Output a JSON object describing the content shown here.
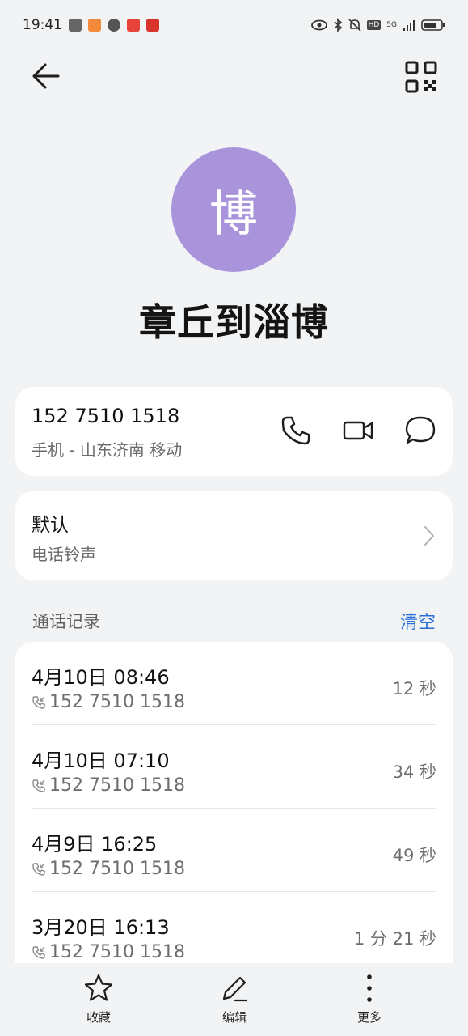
{
  "status_bar": {
    "time": "19:41",
    "signal_label": "5G",
    "hd_label": "HD"
  },
  "contact": {
    "avatar_char": "博",
    "name": "章丘到淄博",
    "avatar_color": "#a994dc"
  },
  "phone_card": {
    "number": "152 7510 1518",
    "description": "手机 - 山东济南 移动"
  },
  "ringtone_card": {
    "title": "默认",
    "subtitle": "电话铃声"
  },
  "call_log": {
    "title": "通话记录",
    "clear_label": "清空",
    "entries": [
      {
        "time": "4月10日 08:46",
        "number": "152 7510 1518",
        "duration": "12 秒"
      },
      {
        "time": "4月10日 07:10",
        "number": "152 7510 1518",
        "duration": "34 秒"
      },
      {
        "time": "4月9日 16:25",
        "number": "152 7510 1518",
        "duration": "49 秒"
      },
      {
        "time": "3月20日 16:13",
        "number": "152 7510 1518",
        "duration": "1 分 21 秒"
      }
    ]
  },
  "bottom_bar": {
    "favorite_label": "收藏",
    "edit_label": "编辑",
    "more_label": "更多"
  },
  "colors": {
    "accent": "#2a6fd8",
    "background": "#f1f3f5"
  }
}
